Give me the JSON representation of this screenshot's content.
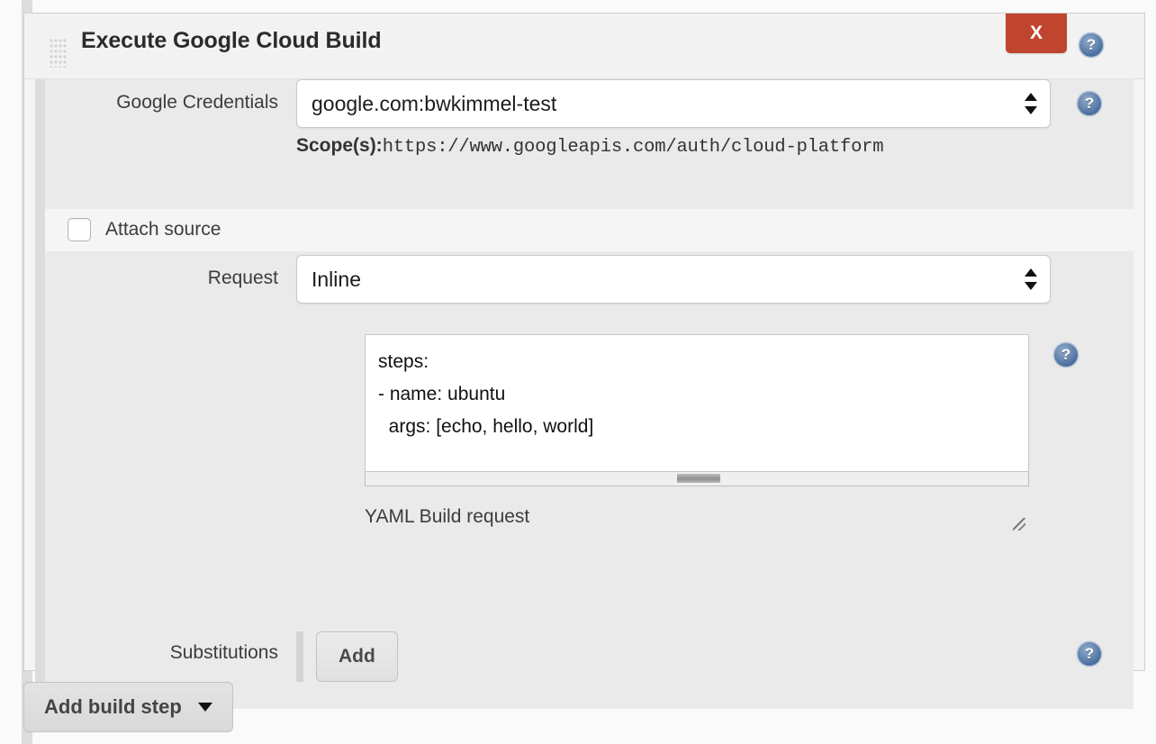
{
  "step": {
    "title": "Execute Google Cloud Build",
    "close_label": "X",
    "drag_handle": "drag-handle-icon",
    "help_icon": "help-icon"
  },
  "rows": {
    "credentials": {
      "label": "Google Credentials",
      "value": "google.com:bwkimmel-test",
      "scope_label": "Scope(s):",
      "scope_url": "https://www.googleapis.com/auth/cloud-platform"
    },
    "attach_source": {
      "label": "Attach source",
      "checked": false
    },
    "request": {
      "label": "Request",
      "value": "Inline",
      "textarea_value": "steps:\n- name: ubuntu\n  args: [echo, hello, world]",
      "caption": "YAML Build request"
    },
    "substitutions": {
      "label": "Substitutions",
      "add_label": "Add"
    }
  },
  "footer": {
    "add_build_step_label": "Add build step",
    "caret_icon": "chevron-down-icon"
  },
  "colors": {
    "close_red": "#c0452f",
    "help_blue": "#4a6f9e",
    "row_shaded": "#eaeaea",
    "row_light": "#f5f5f5"
  }
}
